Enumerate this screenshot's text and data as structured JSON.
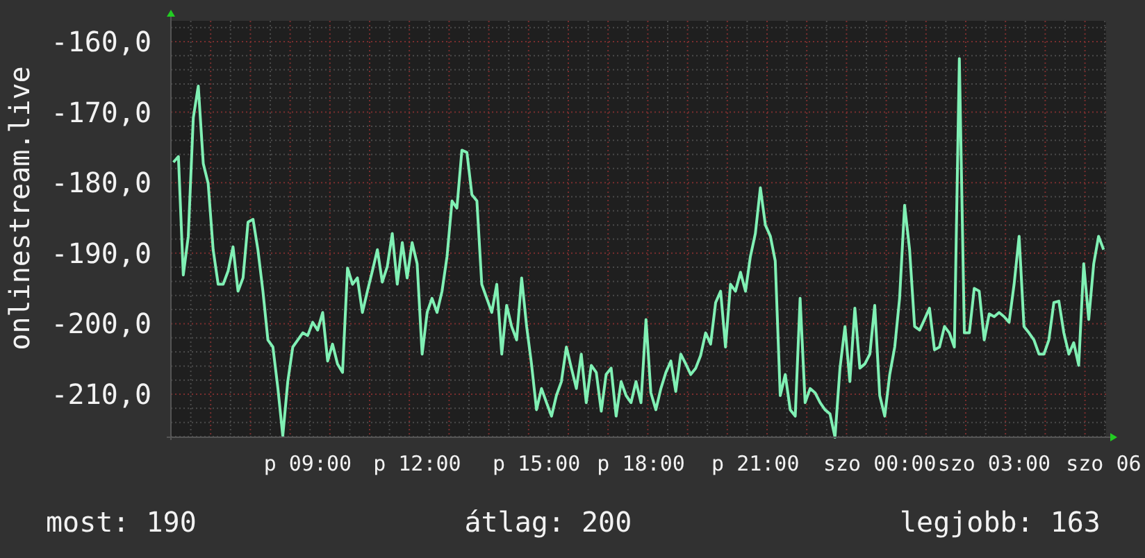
{
  "chart": {
    "chart_data": {
      "type": "line",
      "ylabel": "onlinestream.live",
      "series": [
        {
          "color": "#80f0b4",
          "values": [
            -177.1,
            -176.3,
            -193.1,
            -187.6,
            -170.8,
            -166.3,
            -177.3,
            -180.1,
            -189.5,
            -194.4,
            -194.4,
            -192.5,
            -189.1,
            -195.4,
            -193.5,
            -185.6,
            -185.2,
            -189.5,
            -195.4,
            -202.3,
            -203.3,
            -209.2,
            -215.9,
            -208.2,
            -203.3,
            -202.3,
            -201.3,
            -201.7,
            -199.8,
            -200.9,
            -198.4,
            -205.3,
            -202.9,
            -205.7,
            -206.9,
            -192.1,
            -194.4,
            -193.5,
            -198.4,
            -195.4,
            -192.5,
            -189.5,
            -194.1,
            -191.9,
            -187.2,
            -194.4,
            -188.5,
            -193.5,
            -188.5,
            -191.5,
            -204.3,
            -198.4,
            -196.4,
            -198.4,
            -195.4,
            -190.5,
            -182.6,
            -183.6,
            -175.4,
            -175.7,
            -181.7,
            -182.6,
            -194.4,
            -196.4,
            -198.4,
            -194.4,
            -204.3,
            -197.4,
            -200.4,
            -202.3,
            -193.5,
            -200.4,
            -205.7,
            -212.2,
            -209.2,
            -211.2,
            -213.1,
            -210.2,
            -208.2,
            -203.3,
            -206.3,
            -209.2,
            -204.3,
            -211.2,
            -205.9,
            -206.9,
            -212.4,
            -207.2,
            -206.3,
            -213.1,
            -208.2,
            -210.2,
            -211.2,
            -208.2,
            -211.2,
            -199.4,
            -209.8,
            -212.2,
            -209.2,
            -206.9,
            -205.3,
            -209.6,
            -204.3,
            -205.7,
            -207.2,
            -206.3,
            -204.5,
            -201.3,
            -202.9,
            -197.0,
            -195.4,
            -203.3,
            -194.4,
            -195.4,
            -192.7,
            -195.4,
            -190.5,
            -187.2,
            -180.7,
            -186.0,
            -187.6,
            -191.1,
            -210.2,
            -207.2,
            -212.2,
            -213.1,
            -196.4,
            -211.2,
            -209.2,
            -209.8,
            -211.2,
            -212.2,
            -212.8,
            -216.1,
            -206.3,
            -200.4,
            -208.2,
            -197.8,
            -206.3,
            -205.7,
            -204.3,
            -197.4,
            -210.2,
            -213.1,
            -207.2,
            -203.3,
            -196.4,
            -183.2,
            -189.5,
            -200.4,
            -200.9,
            -199.4,
            -197.8,
            -203.7,
            -203.3,
            -200.4,
            -201.3,
            -203.3,
            -162.4,
            -201.3,
            -201.3,
            -195.0,
            -195.4,
            -202.3,
            -198.6,
            -199.0,
            -198.4,
            -199.0,
            -199.8,
            -194.4,
            -187.6,
            -200.4,
            -201.3,
            -202.3,
            -204.3,
            -204.3,
            -202.3,
            -197.0,
            -196.8,
            -201.3,
            -204.3,
            -202.7,
            -205.9,
            -191.5,
            -199.4,
            -191.5,
            -187.6,
            -189.5
          ]
        }
      ],
      "grid": true,
      "ylim": [
        -216.1,
        -157.05
      ],
      "categories": [
        null,
        null,
        null,
        null,
        null,
        null,
        null,
        null,
        null,
        null,
        null,
        null,
        null,
        null,
        null,
        null,
        null,
        null,
        null,
        null,
        null,
        null,
        null,
        null,
        null,
        null,
        null,
        "p 09:00",
        null,
        null,
        null,
        null,
        null,
        null,
        null,
        null,
        null,
        null,
        null,
        null,
        null,
        null,
        null,
        null,
        null,
        null,
        null,
        null,
        null,
        "p 12:00",
        null,
        null,
        null,
        null,
        null,
        null,
        null,
        null,
        null,
        null,
        null,
        null,
        null,
        null,
        null,
        null,
        null,
        null,
        null,
        null,
        null,
        null,
        null,
        "p 15:00",
        null,
        null,
        null,
        null,
        null,
        null,
        null,
        null,
        null,
        null,
        null,
        null,
        null,
        null,
        null,
        null,
        null,
        null,
        null,
        null,
        "p 18:00",
        null,
        null,
        null,
        null,
        null,
        null,
        null,
        null,
        null,
        null,
        null,
        null,
        null,
        null,
        null,
        null,
        null,
        null,
        null,
        null,
        null,
        null,
        "p 21:00",
        null,
        null,
        null,
        null,
        null,
        null,
        null,
        null,
        null,
        null,
        null,
        null,
        null,
        null,
        null,
        null,
        null,
        null,
        null,
        null,
        null,
        null,
        null,
        null,
        "szo 00:00",
        null,
        null,
        null,
        null,
        null,
        null,
        null,
        null,
        null,
        null,
        null,
        null,
        null,
        null,
        null,
        null,
        null,
        null,
        null,
        null,
        null,
        null,
        "szo 03:00",
        null,
        null,
        null,
        null,
        null,
        null,
        null,
        null,
        null,
        null,
        null,
        null,
        null,
        null,
        null,
        null,
        null,
        null,
        null,
        null,
        null,
        "szo 06"
      ],
      "yticks": [
        {
          "value": -160,
          "label": "-160,0"
        },
        {
          "value": -170,
          "label": "-170,0"
        },
        {
          "value": -180,
          "label": "-180,0"
        },
        {
          "value": -190,
          "label": "-190,0"
        },
        {
          "value": -200,
          "label": "-200,0"
        },
        {
          "value": -210,
          "label": "-210,0"
        }
      ]
    }
  },
  "stats": [
    "most: 190",
    "átlag: 200",
    "legjobb: 163"
  ]
}
